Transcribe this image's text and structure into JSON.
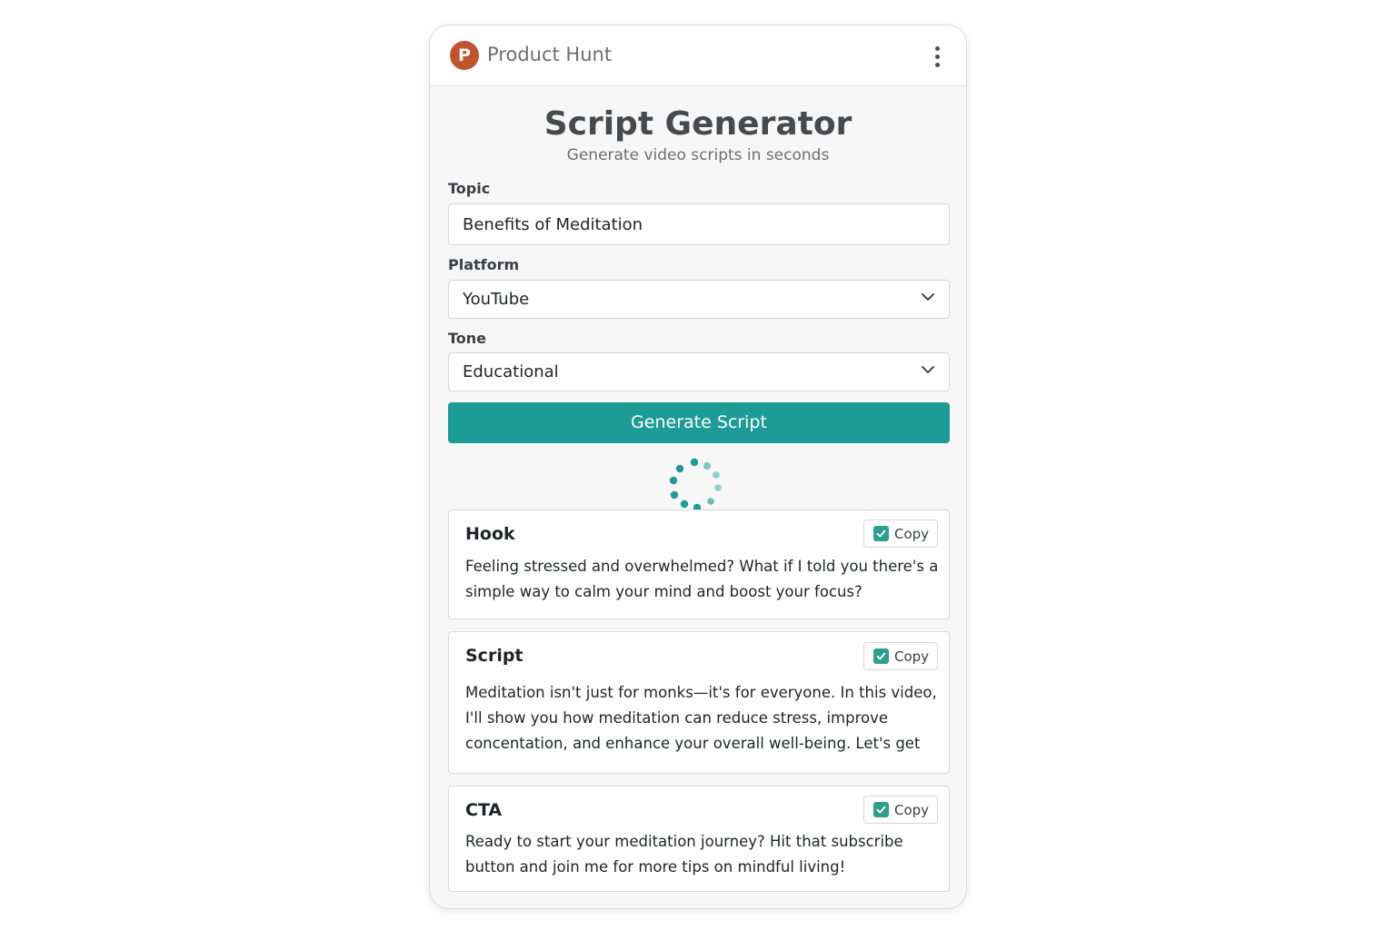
{
  "header": {
    "brand": "Product Hunt",
    "logo_letter": "P",
    "logo_color": "#c0542e",
    "menu_icon": "kebab-menu-icon"
  },
  "main": {
    "title": "Script Generator",
    "subtitle": "Generate video scripts in seconds"
  },
  "form": {
    "topic_label": "Topic",
    "topic_value": "Benefits of Meditation",
    "platform_label": "Platform",
    "platform_value": "YouTube",
    "tone_label": "Tone",
    "tone_value": "Educational",
    "generate_label": "Generate Script",
    "accent_color": "#1d9b97"
  },
  "results": [
    {
      "title": "Hook",
      "copy_label": "Copy",
      "text": "Feeling stressed and overwhelmed? What if I told you there's a simple way to calm your mind and boost your focus?"
    },
    {
      "title": "Script",
      "copy_label": "Copy",
      "text": "Meditation isn't just for monks—it's for everyone. In this video, I'll show you how meditation can reduce stress, improve concentation, and enhance your overall well-being. Let's get"
    },
    {
      "title": "CTA",
      "copy_label": "Copy",
      "text": "Ready to start your meditation journey? Hit that subscribe button and join me for more tips on mindful living!"
    }
  ]
}
